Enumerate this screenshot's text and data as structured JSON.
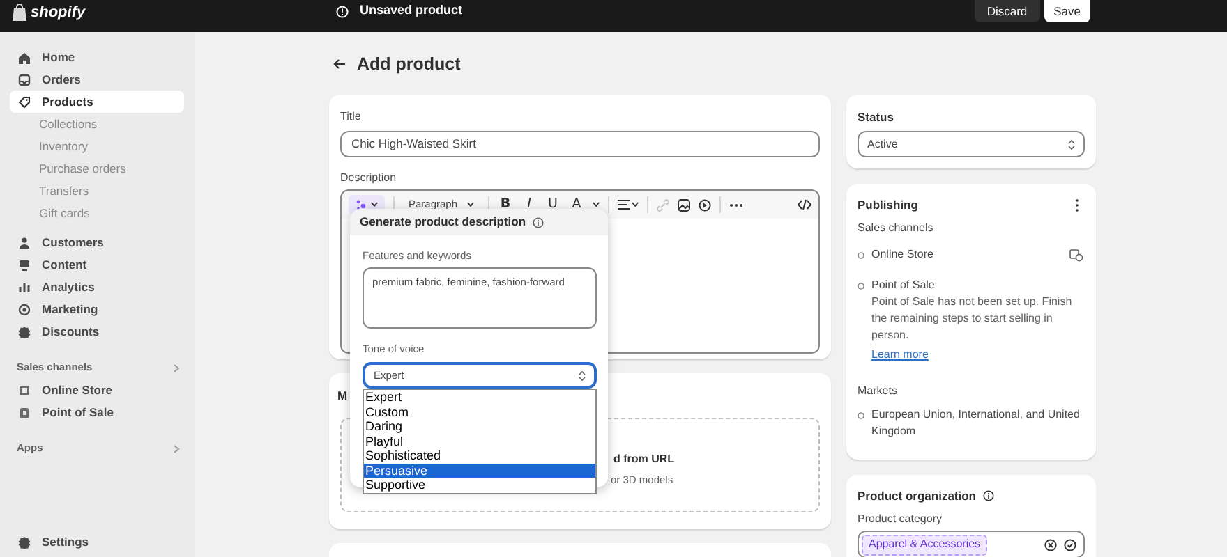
{
  "top_bar": {
    "logo": "shopify",
    "message": "Unsaved product",
    "buttons": [
      {
        "label": "Discard",
        "kind": "secondary"
      },
      {
        "label": "Save",
        "kind": "primary"
      }
    ]
  },
  "sidebar": {
    "items": [
      {
        "label": "Home",
        "selected": false
      },
      {
        "label": "Orders",
        "selected": false
      },
      {
        "label": "Products",
        "selected": true,
        "children": [
          {
            "label": "Collections",
            "selected": false
          },
          {
            "label": "Inventory",
            "selected": false
          },
          {
            "label": "Purchase orders",
            "selected": false
          },
          {
            "label": "Transfers",
            "selected": false
          },
          {
            "label": "Gift cards",
            "selected": false
          }
        ]
      },
      {
        "label": "Customers",
        "selected": false
      },
      {
        "label": "Content",
        "selected": false
      },
      {
        "label": "Analytics",
        "selected": false
      },
      {
        "label": "Marketing",
        "selected": false
      },
      {
        "label": "Discounts",
        "selected": false
      }
    ],
    "sections": [
      {
        "title": "Sales channels",
        "items": [
          {
            "label": "Online Store",
            "selected": false
          },
          {
            "label": "Point of Sale",
            "selected": false
          }
        ]
      },
      {
        "title": "Apps"
      }
    ],
    "settings": "Settings"
  },
  "page": {
    "title": "Add product"
  },
  "product_card": {
    "title_label": "Title",
    "title_value": "Chic High-Waisted Skirt",
    "description_label": "Description",
    "paragraph_style": "Paragraph",
    "format_buttons": [
      "B",
      "I",
      "U",
      "A"
    ]
  },
  "generate_popover": {
    "title": "Generate product description",
    "features_label": "Features and keywords",
    "features_value": "premium fabric, feminine, fashion-forward",
    "tone_label": "Tone of voice",
    "tone_value": "Expert",
    "options": [
      {
        "label": "Expert",
        "selected": false
      },
      {
        "label": "Custom",
        "selected": false
      },
      {
        "label": "Daring",
        "selected": false
      },
      {
        "label": "Playful",
        "selected": false
      },
      {
        "label": "Sophisticated",
        "selected": false
      },
      {
        "label": "Persuasive",
        "selected": true
      },
      {
        "label": "Supportive",
        "selected": false
      }
    ]
  },
  "media_card": {
    "title_fragment": "M",
    "link_fragment": "d from URL",
    "hint_fragment": "or 3D models"
  },
  "status_card": {
    "title": "Status",
    "value": "Active"
  },
  "publishing_card": {
    "title": "Publishing",
    "sales_channels_label": "Sales channels",
    "channels": [
      {
        "name": "Online Store"
      },
      {
        "name": "Point of Sale",
        "note": "Point of Sale has not been set up. Finish the remaining steps to start selling in person.",
        "link": "Learn more"
      }
    ],
    "markets_label": "Markets",
    "markets": [
      {
        "name": "European Union, International, and United Kingdom"
      }
    ]
  },
  "organization_card": {
    "title": "Product organization",
    "category_label": "Product category",
    "category_tag": "Apparel & Accessories"
  }
}
